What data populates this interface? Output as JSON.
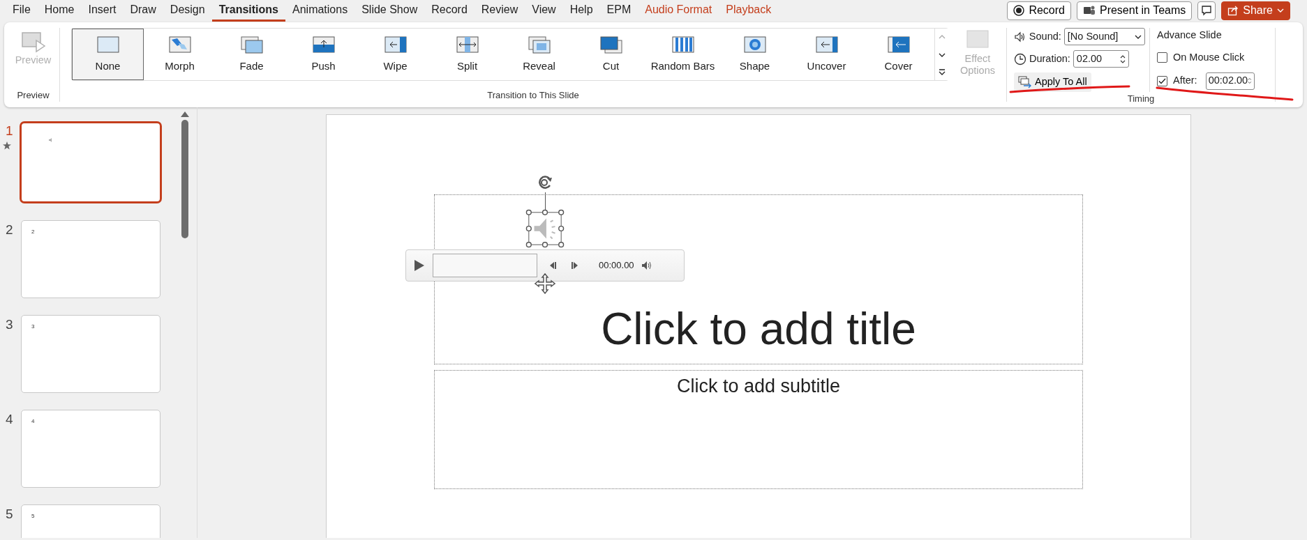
{
  "menu_tabs": [
    {
      "label": "File",
      "selected": false,
      "kind": "normal"
    },
    {
      "label": "Home",
      "selected": false,
      "kind": "normal"
    },
    {
      "label": "Insert",
      "selected": false,
      "kind": "normal"
    },
    {
      "label": "Draw",
      "selected": false,
      "kind": "normal"
    },
    {
      "label": "Design",
      "selected": false,
      "kind": "normal"
    },
    {
      "label": "Transitions",
      "selected": true,
      "kind": "normal"
    },
    {
      "label": "Animations",
      "selected": false,
      "kind": "normal"
    },
    {
      "label": "Slide Show",
      "selected": false,
      "kind": "normal"
    },
    {
      "label": "Record",
      "selected": false,
      "kind": "normal"
    },
    {
      "label": "Review",
      "selected": false,
      "kind": "normal"
    },
    {
      "label": "View",
      "selected": false,
      "kind": "normal"
    },
    {
      "label": "Help",
      "selected": false,
      "kind": "normal"
    },
    {
      "label": "EPM",
      "selected": false,
      "kind": "normal"
    },
    {
      "label": "Audio Format",
      "selected": false,
      "kind": "contextual"
    },
    {
      "label": "Playback",
      "selected": false,
      "kind": "contextual"
    }
  ],
  "header_buttons": [
    {
      "label": "Record",
      "kind": "record"
    },
    {
      "label": "Present in Teams",
      "kind": "teams"
    },
    {
      "kind": "comment"
    },
    {
      "label": "Share",
      "kind": "share"
    }
  ],
  "preview_group": {
    "button": "Preview",
    "disabled": true,
    "group_label": "Preview"
  },
  "transitions": [
    {
      "label": "None",
      "selected": true
    },
    {
      "label": "Morph",
      "selected": false
    },
    {
      "label": "Fade",
      "selected": false
    },
    {
      "label": "Push",
      "selected": false
    },
    {
      "label": "Wipe",
      "selected": false
    },
    {
      "label": "Split",
      "selected": false
    },
    {
      "label": "Reveal",
      "selected": false
    },
    {
      "label": "Cut",
      "selected": false
    },
    {
      "label": "Random Bars",
      "selected": false
    },
    {
      "label": "Shape",
      "selected": false
    },
    {
      "label": "Uncover",
      "selected": false
    },
    {
      "label": "Cover",
      "selected": false
    }
  ],
  "effect_options": {
    "label": "Effect Options",
    "disabled": true
  },
  "transition_group_label": "Transition to This Slide",
  "timing": {
    "sound_label": "Sound:",
    "sound_value": "[No Sound]",
    "duration_label": "Duration:",
    "duration_value": "02.00",
    "apply_all": "Apply To All",
    "advance_heading": "Advance Slide",
    "on_mouse_click": {
      "label": "On Mouse Click",
      "checked": false
    },
    "after": {
      "label": "After:",
      "checked": true,
      "value": "00:02.00"
    },
    "group_label": "Timing"
  },
  "slides": [
    {
      "number": "1",
      "selected": true,
      "has_transition": true,
      "kind": "audio"
    },
    {
      "number": "2",
      "selected": false,
      "has_transition": false,
      "kind": "text",
      "text": "2"
    },
    {
      "number": "3",
      "selected": false,
      "has_transition": false,
      "kind": "text",
      "text": "3"
    },
    {
      "number": "4",
      "selected": false,
      "has_transition": false,
      "kind": "text",
      "text": "4"
    },
    {
      "number": "5",
      "selected": false,
      "has_transition": false,
      "kind": "text",
      "text": "5"
    }
  ],
  "slide": {
    "title_placeholder": "Click to add title",
    "subtitle_placeholder": "Click to add subtitle",
    "media_player": {
      "time": "00:00.00"
    }
  }
}
